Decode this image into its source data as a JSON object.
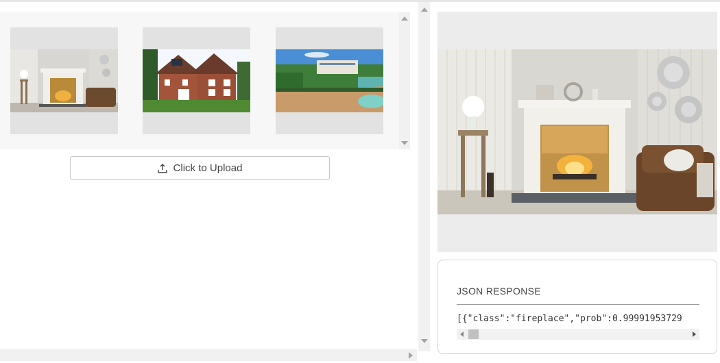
{
  "gallery": {
    "images": [
      {
        "name": "fireplace-living-room"
      },
      {
        "name": "brick-house"
      },
      {
        "name": "tropical-beach"
      }
    ]
  },
  "upload": {
    "label": "Click to Upload",
    "icon": "upload-icon"
  },
  "preview": {
    "image": "fireplace-living-room"
  },
  "json_response": {
    "title": "JSON RESPONSE",
    "text": "[{\"class\":\"fireplace\",\"prob\":0.99991953729"
  },
  "colors": {
    "panel_bg": "#ececec",
    "thumb_bg": "#e2e2e2",
    "gallery_bg": "#f7f7f7",
    "scrollbar_bg": "#f1f1f1"
  }
}
